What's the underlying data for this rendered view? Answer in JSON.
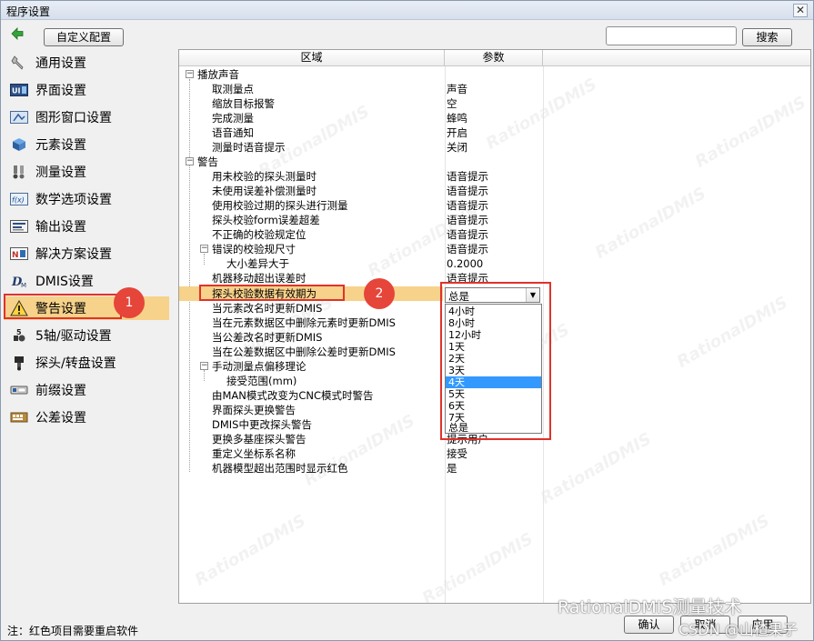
{
  "window": {
    "title": "程序设置",
    "close_label": "✕"
  },
  "toolbar": {
    "custom_config_label": "自定义配置",
    "search_value": "",
    "search_label": "搜索"
  },
  "sidebar": {
    "items": [
      {
        "label": "通用设置"
      },
      {
        "label": "界面设置"
      },
      {
        "label": "图形窗口设置"
      },
      {
        "label": "元素设置"
      },
      {
        "label": "测量设置"
      },
      {
        "label": "数学选项设置"
      },
      {
        "label": "输出设置"
      },
      {
        "label": "解决方案设置"
      },
      {
        "label": "DMIS设置"
      },
      {
        "label": "警告设置"
      },
      {
        "label": "5轴/驱动设置"
      },
      {
        "label": "探头/转盘设置"
      },
      {
        "label": "前缀设置"
      },
      {
        "label": "公差设置"
      }
    ],
    "active_index": 9,
    "badge1": "1"
  },
  "table": {
    "col_region": "区域",
    "col_param": "参数",
    "watermark": "RationalDMIS",
    "rows": [
      {
        "label": "播放声音",
        "value": ""
      },
      {
        "label": "取测量点",
        "value": "声音"
      },
      {
        "label": "缩放目标报警",
        "value": "空"
      },
      {
        "label": "完成测量",
        "value": "蜂鸣"
      },
      {
        "label": "语音通知",
        "value": "开启"
      },
      {
        "label": "测量时语音提示",
        "value": "关闭"
      },
      {
        "label": "警告",
        "value": ""
      },
      {
        "label": "用未校验的探头测量时",
        "value": "语音提示"
      },
      {
        "label": "未使用误差补偿测量时",
        "value": "语音提示"
      },
      {
        "label": "使用校验过期的探头进行测量",
        "value": "语音提示"
      },
      {
        "label": "探头校验form误差超差",
        "value": "语音提示"
      },
      {
        "label": "不正确的校验规定位",
        "value": "语音提示"
      },
      {
        "label": "错误的校验规尺寸",
        "value": "语音提示"
      },
      {
        "label": "大小差异大于",
        "value": "0.2000"
      },
      {
        "label": "机器移动超出误差时",
        "value": "语音提示"
      },
      {
        "label": "探头校验数据有效期为",
        "value": ""
      },
      {
        "label": "当元素改名时更新DMIS",
        "value": ""
      },
      {
        "label": "当在元素数据区中删除元素时更新DMIS",
        "value": ""
      },
      {
        "label": "当公差改名时更新DMIS",
        "value": ""
      },
      {
        "label": "当在公差数据区中删除公差时更新DMIS",
        "value": ""
      },
      {
        "label": "手动测量点偏移理论",
        "value": ""
      },
      {
        "label": "接受范围(mm)",
        "value": ""
      },
      {
        "label": "由MAN模式改变为CNC模式时警告",
        "value": ""
      },
      {
        "label": "界面探头更换警告",
        "value": ""
      },
      {
        "label": "DMIS中更改探头警告",
        "value": ""
      },
      {
        "label": "更换多基座探头警告",
        "value": "提示用户"
      },
      {
        "label": "重定义坐标系名称",
        "value": "接受"
      },
      {
        "label": "机器模型超出范围时显示红色",
        "value": "是"
      }
    ],
    "badge2": "2"
  },
  "combo": {
    "selected": "总是",
    "arrow": "▼",
    "options": [
      "4小时",
      "8小时",
      "12小时",
      "1天",
      "2天",
      "3天",
      "4天",
      "5天",
      "6天",
      "7天",
      "总是"
    ],
    "hover_index": 6
  },
  "footer": {
    "note": "注：红色项目需要重启软件",
    "ok_label": "确认",
    "cancel_label": "取消",
    "apply_label": "应用",
    "brand_text": "RationalDMIS测量技术",
    "csdn_text": "CSDN @山楂果子"
  }
}
